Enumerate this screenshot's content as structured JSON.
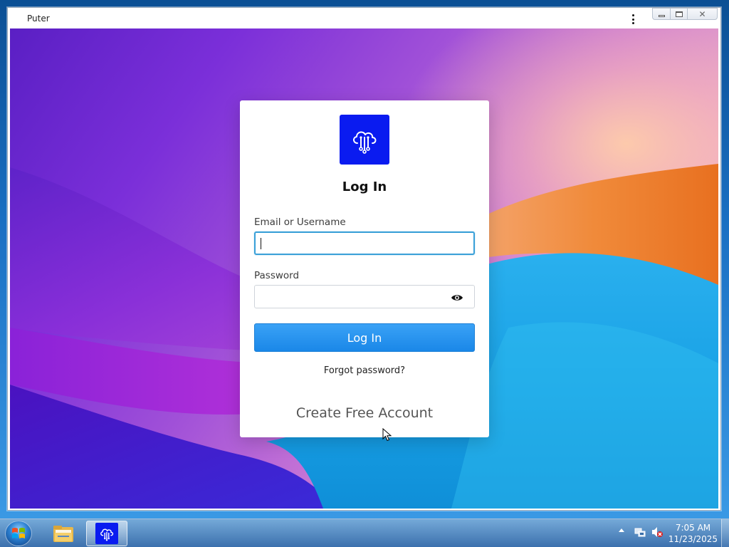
{
  "window": {
    "title": "Puter",
    "menu_icon": "kebab-menu-icon",
    "minimize_icon": "minimize-icon",
    "maximize_icon": "maximize-icon",
    "close_icon": "close-icon"
  },
  "login": {
    "logo_icon": "puter-cloud-circuit-logo",
    "title": "Log In",
    "email_label": "Email or Username",
    "email_value": "",
    "password_label": "Password",
    "password_value": "",
    "show_password_icon": "eye-icon",
    "submit_label": "Log In",
    "forgot_label": "Forgot password?",
    "create_label": "Create Free Account"
  },
  "taskbar": {
    "start_icon": "windows-start-orb",
    "pinned": [
      {
        "name": "File Explorer",
        "icon": "folder-icon"
      },
      {
        "name": "Puter",
        "icon": "puter-logo-icon",
        "active": true
      }
    ],
    "tray_icons": [
      "show-hidden-icons-arrow",
      "network-icon",
      "volume-muted-icon"
    ],
    "time": "7:05 AM",
    "date": "11/23/2025"
  },
  "colors": {
    "accent": "#1a87e8",
    "logo_bg": "#0a1bf0",
    "focus_border": "#3aa0d8"
  }
}
